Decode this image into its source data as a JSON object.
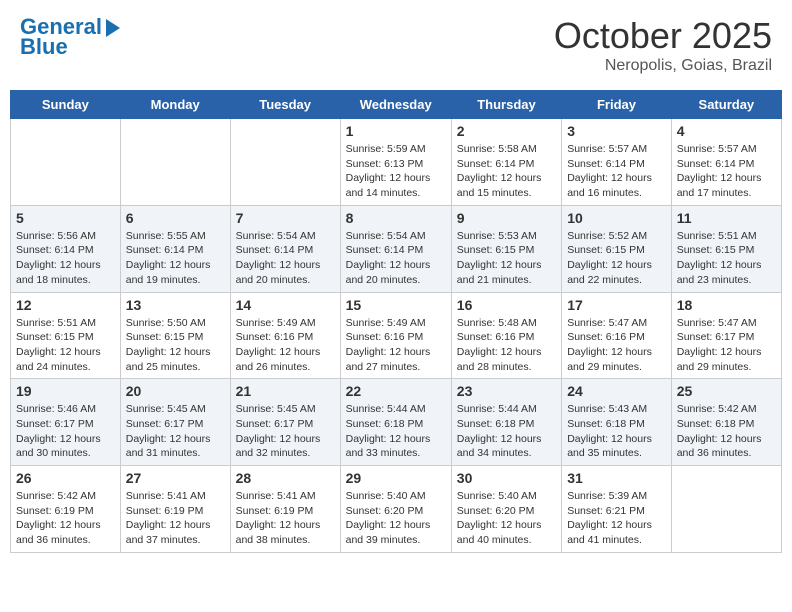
{
  "header": {
    "logo_line1": "General",
    "logo_line2": "Blue",
    "month": "October 2025",
    "location": "Neropolis, Goias, Brazil"
  },
  "weekdays": [
    "Sunday",
    "Monday",
    "Tuesday",
    "Wednesday",
    "Thursday",
    "Friday",
    "Saturday"
  ],
  "weeks": [
    [
      {
        "day": "",
        "sunrise": "",
        "sunset": "",
        "daylight": ""
      },
      {
        "day": "",
        "sunrise": "",
        "sunset": "",
        "daylight": ""
      },
      {
        "day": "",
        "sunrise": "",
        "sunset": "",
        "daylight": ""
      },
      {
        "day": "1",
        "sunrise": "Sunrise: 5:59 AM",
        "sunset": "Sunset: 6:13 PM",
        "daylight": "Daylight: 12 hours and 14 minutes."
      },
      {
        "day": "2",
        "sunrise": "Sunrise: 5:58 AM",
        "sunset": "Sunset: 6:14 PM",
        "daylight": "Daylight: 12 hours and 15 minutes."
      },
      {
        "day": "3",
        "sunrise": "Sunrise: 5:57 AM",
        "sunset": "Sunset: 6:14 PM",
        "daylight": "Daylight: 12 hours and 16 minutes."
      },
      {
        "day": "4",
        "sunrise": "Sunrise: 5:57 AM",
        "sunset": "Sunset: 6:14 PM",
        "daylight": "Daylight: 12 hours and 17 minutes."
      }
    ],
    [
      {
        "day": "5",
        "sunrise": "Sunrise: 5:56 AM",
        "sunset": "Sunset: 6:14 PM",
        "daylight": "Daylight: 12 hours and 18 minutes."
      },
      {
        "day": "6",
        "sunrise": "Sunrise: 5:55 AM",
        "sunset": "Sunset: 6:14 PM",
        "daylight": "Daylight: 12 hours and 19 minutes."
      },
      {
        "day": "7",
        "sunrise": "Sunrise: 5:54 AM",
        "sunset": "Sunset: 6:14 PM",
        "daylight": "Daylight: 12 hours and 20 minutes."
      },
      {
        "day": "8",
        "sunrise": "Sunrise: 5:54 AM",
        "sunset": "Sunset: 6:14 PM",
        "daylight": "Daylight: 12 hours and 20 minutes."
      },
      {
        "day": "9",
        "sunrise": "Sunrise: 5:53 AM",
        "sunset": "Sunset: 6:15 PM",
        "daylight": "Daylight: 12 hours and 21 minutes."
      },
      {
        "day": "10",
        "sunrise": "Sunrise: 5:52 AM",
        "sunset": "Sunset: 6:15 PM",
        "daylight": "Daylight: 12 hours and 22 minutes."
      },
      {
        "day": "11",
        "sunrise": "Sunrise: 5:51 AM",
        "sunset": "Sunset: 6:15 PM",
        "daylight": "Daylight: 12 hours and 23 minutes."
      }
    ],
    [
      {
        "day": "12",
        "sunrise": "Sunrise: 5:51 AM",
        "sunset": "Sunset: 6:15 PM",
        "daylight": "Daylight: 12 hours and 24 minutes."
      },
      {
        "day": "13",
        "sunrise": "Sunrise: 5:50 AM",
        "sunset": "Sunset: 6:15 PM",
        "daylight": "Daylight: 12 hours and 25 minutes."
      },
      {
        "day": "14",
        "sunrise": "Sunrise: 5:49 AM",
        "sunset": "Sunset: 6:16 PM",
        "daylight": "Daylight: 12 hours and 26 minutes."
      },
      {
        "day": "15",
        "sunrise": "Sunrise: 5:49 AM",
        "sunset": "Sunset: 6:16 PM",
        "daylight": "Daylight: 12 hours and 27 minutes."
      },
      {
        "day": "16",
        "sunrise": "Sunrise: 5:48 AM",
        "sunset": "Sunset: 6:16 PM",
        "daylight": "Daylight: 12 hours and 28 minutes."
      },
      {
        "day": "17",
        "sunrise": "Sunrise: 5:47 AM",
        "sunset": "Sunset: 6:16 PM",
        "daylight": "Daylight: 12 hours and 29 minutes."
      },
      {
        "day": "18",
        "sunrise": "Sunrise: 5:47 AM",
        "sunset": "Sunset: 6:17 PM",
        "daylight": "Daylight: 12 hours and 29 minutes."
      }
    ],
    [
      {
        "day": "19",
        "sunrise": "Sunrise: 5:46 AM",
        "sunset": "Sunset: 6:17 PM",
        "daylight": "Daylight: 12 hours and 30 minutes."
      },
      {
        "day": "20",
        "sunrise": "Sunrise: 5:45 AM",
        "sunset": "Sunset: 6:17 PM",
        "daylight": "Daylight: 12 hours and 31 minutes."
      },
      {
        "day": "21",
        "sunrise": "Sunrise: 5:45 AM",
        "sunset": "Sunset: 6:17 PM",
        "daylight": "Daylight: 12 hours and 32 minutes."
      },
      {
        "day": "22",
        "sunrise": "Sunrise: 5:44 AM",
        "sunset": "Sunset: 6:18 PM",
        "daylight": "Daylight: 12 hours and 33 minutes."
      },
      {
        "day": "23",
        "sunrise": "Sunrise: 5:44 AM",
        "sunset": "Sunset: 6:18 PM",
        "daylight": "Daylight: 12 hours and 34 minutes."
      },
      {
        "day": "24",
        "sunrise": "Sunrise: 5:43 AM",
        "sunset": "Sunset: 6:18 PM",
        "daylight": "Daylight: 12 hours and 35 minutes."
      },
      {
        "day": "25",
        "sunrise": "Sunrise: 5:42 AM",
        "sunset": "Sunset: 6:18 PM",
        "daylight": "Daylight: 12 hours and 36 minutes."
      }
    ],
    [
      {
        "day": "26",
        "sunrise": "Sunrise: 5:42 AM",
        "sunset": "Sunset: 6:19 PM",
        "daylight": "Daylight: 12 hours and 36 minutes."
      },
      {
        "day": "27",
        "sunrise": "Sunrise: 5:41 AM",
        "sunset": "Sunset: 6:19 PM",
        "daylight": "Daylight: 12 hours and 37 minutes."
      },
      {
        "day": "28",
        "sunrise": "Sunrise: 5:41 AM",
        "sunset": "Sunset: 6:19 PM",
        "daylight": "Daylight: 12 hours and 38 minutes."
      },
      {
        "day": "29",
        "sunrise": "Sunrise: 5:40 AM",
        "sunset": "Sunset: 6:20 PM",
        "daylight": "Daylight: 12 hours and 39 minutes."
      },
      {
        "day": "30",
        "sunrise": "Sunrise: 5:40 AM",
        "sunset": "Sunset: 6:20 PM",
        "daylight": "Daylight: 12 hours and 40 minutes."
      },
      {
        "day": "31",
        "sunrise": "Sunrise: 5:39 AM",
        "sunset": "Sunset: 6:21 PM",
        "daylight": "Daylight: 12 hours and 41 minutes."
      },
      {
        "day": "",
        "sunrise": "",
        "sunset": "",
        "daylight": ""
      }
    ]
  ]
}
